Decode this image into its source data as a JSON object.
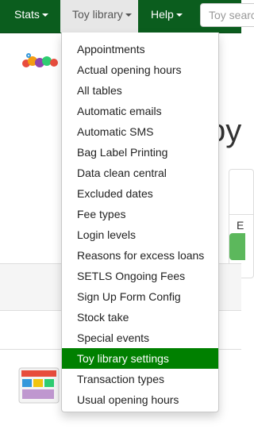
{
  "navbar": {
    "stats_label": "Stats",
    "toy_library_label": "Toy library",
    "help_label": "Help",
    "search_placeholder": "Toy search"
  },
  "page": {
    "heading_fragment": "oy",
    "side_panel_text": "E"
  },
  "menu": {
    "items": [
      {
        "label": "Appointments"
      },
      {
        "label": "Actual opening hours"
      },
      {
        "label": "All tables"
      },
      {
        "label": "Automatic emails"
      },
      {
        "label": "Automatic SMS"
      },
      {
        "label": "Bag Label Printing"
      },
      {
        "label": "Data clean central"
      },
      {
        "label": "Excluded dates"
      },
      {
        "label": "Fee types"
      },
      {
        "label": "Login levels"
      },
      {
        "label": "Reasons for excess loans"
      },
      {
        "label": "SETLS Ongoing Fees"
      },
      {
        "label": "Sign Up Form Config"
      },
      {
        "label": "Stock take"
      },
      {
        "label": "Special events"
      },
      {
        "label": "Toy library settings",
        "active": true
      },
      {
        "label": "Transaction types"
      },
      {
        "label": "Usual opening hours"
      }
    ]
  },
  "colors": {
    "navbar": "#0b5d1e",
    "active_item": "#008000",
    "button_green": "#5cb85c"
  }
}
